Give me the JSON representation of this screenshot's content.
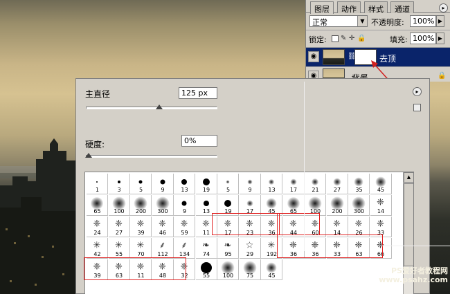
{
  "layers_panel": {
    "tabs": [
      "图层",
      "动作",
      "样式",
      "通道"
    ],
    "blend_mode": "正常",
    "opacity_label": "不透明度:",
    "opacity_value": "100%",
    "lock_label": "锁定:",
    "fill_label": "填充:",
    "fill_value": "100%",
    "layers": [
      {
        "name": "去顶",
        "selected": true
      },
      {
        "name": "背景",
        "selected": false
      }
    ]
  },
  "brush_picker": {
    "master_diameter_label": "主直径",
    "master_diameter_value": "125 px",
    "diameter_slider_fraction": 0.56,
    "hardness_label": "硬度:",
    "hardness_value": "0%",
    "hardness_slider_fraction": 0.0,
    "brushes": [
      {
        "size": "1",
        "kind": "hard"
      },
      {
        "size": "3",
        "kind": "hard"
      },
      {
        "size": "5",
        "kind": "hard"
      },
      {
        "size": "9",
        "kind": "hard"
      },
      {
        "size": "13",
        "kind": "hard"
      },
      {
        "size": "19",
        "kind": "hard"
      },
      {
        "size": "5",
        "kind": "soft"
      },
      {
        "size": "9",
        "kind": "soft"
      },
      {
        "size": "13",
        "kind": "soft"
      },
      {
        "size": "17",
        "kind": "soft"
      },
      {
        "size": "21",
        "kind": "soft"
      },
      {
        "size": "27",
        "kind": "soft"
      },
      {
        "size": "35",
        "kind": "soft"
      },
      {
        "size": "45",
        "kind": "soft"
      },
      {
        "size": "65",
        "kind": "soft"
      },
      {
        "size": "100",
        "kind": "soft"
      },
      {
        "size": "200",
        "kind": "soft"
      },
      {
        "size": "300",
        "kind": "soft"
      },
      {
        "size": "9",
        "kind": "hard"
      },
      {
        "size": "13",
        "kind": "hard"
      },
      {
        "size": "19",
        "kind": "hard"
      },
      {
        "size": "17",
        "kind": "soft"
      },
      {
        "size": "45",
        "kind": "soft"
      },
      {
        "size": "65",
        "kind": "soft"
      },
      {
        "size": "100",
        "kind": "soft"
      },
      {
        "size": "200",
        "kind": "soft"
      },
      {
        "size": "300",
        "kind": "soft"
      },
      {
        "size": "14",
        "kind": "texture"
      },
      {
        "size": "24",
        "kind": "texture"
      },
      {
        "size": "27",
        "kind": "texture"
      },
      {
        "size": "39",
        "kind": "texture"
      },
      {
        "size": "46",
        "kind": "texture"
      },
      {
        "size": "59",
        "kind": "texture"
      },
      {
        "size": "11",
        "kind": "texture"
      },
      {
        "size": "17",
        "kind": "texture"
      },
      {
        "size": "23",
        "kind": "texture"
      },
      {
        "size": "36",
        "kind": "texture"
      },
      {
        "size": "44",
        "kind": "texture"
      },
      {
        "size": "60",
        "kind": "texture"
      },
      {
        "size": "14",
        "kind": "texture"
      },
      {
        "size": "26",
        "kind": "texture"
      },
      {
        "size": "33",
        "kind": "texture"
      },
      {
        "size": "42",
        "kind": "star"
      },
      {
        "size": "55",
        "kind": "star"
      },
      {
        "size": "70",
        "kind": "star"
      },
      {
        "size": "112",
        "kind": "grass"
      },
      {
        "size": "134",
        "kind": "grass"
      },
      {
        "size": "74",
        "kind": "leaf"
      },
      {
        "size": "95",
        "kind": "leaf"
      },
      {
        "size": "29",
        "kind": "starshape"
      },
      {
        "size": "192",
        "kind": "star"
      },
      {
        "size": "36",
        "kind": "texture"
      },
      {
        "size": "36",
        "kind": "texture"
      },
      {
        "size": "33",
        "kind": "texture"
      },
      {
        "size": "63",
        "kind": "texture"
      },
      {
        "size": "66",
        "kind": "texture"
      },
      {
        "size": "39",
        "kind": "texture"
      },
      {
        "size": "63",
        "kind": "texture"
      },
      {
        "size": "11",
        "kind": "texture"
      },
      {
        "size": "48",
        "kind": "texture"
      },
      {
        "size": "32",
        "kind": "texture"
      },
      {
        "size": "55",
        "kind": "hard"
      },
      {
        "size": "100",
        "kind": "soft"
      },
      {
        "size": "75",
        "kind": "soft"
      },
      {
        "size": "45",
        "kind": "soft"
      }
    ]
  },
  "watermark": {
    "line1": "PS爱好者教程网",
    "line2": "www.psahz.com"
  }
}
